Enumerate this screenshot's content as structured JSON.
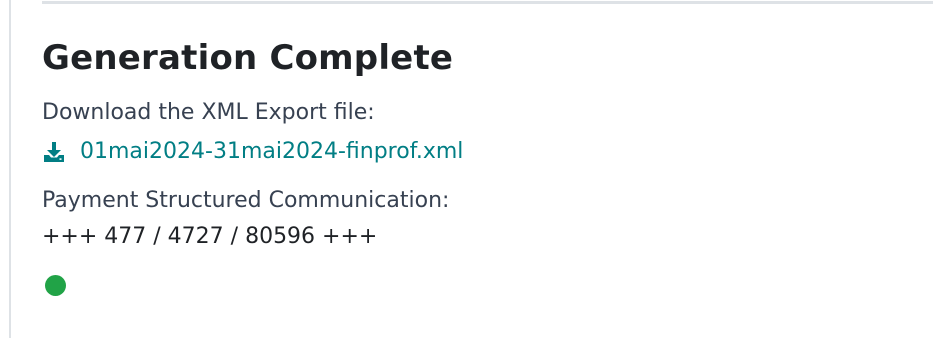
{
  "panel": {
    "title": "Generation Complete",
    "download_label": "Download the XML Export file:",
    "download_file": "01mai2024-31mai2024-finprof.xml",
    "download_icon": "download-icon",
    "communication_label": "Payment Structured Communication:",
    "communication_value": "+++ 477 / 4727 / 80596 +++",
    "status_icon": "status-dot-icon"
  },
  "colors": {
    "link": "#017e84",
    "status_ok": "#21a347"
  }
}
